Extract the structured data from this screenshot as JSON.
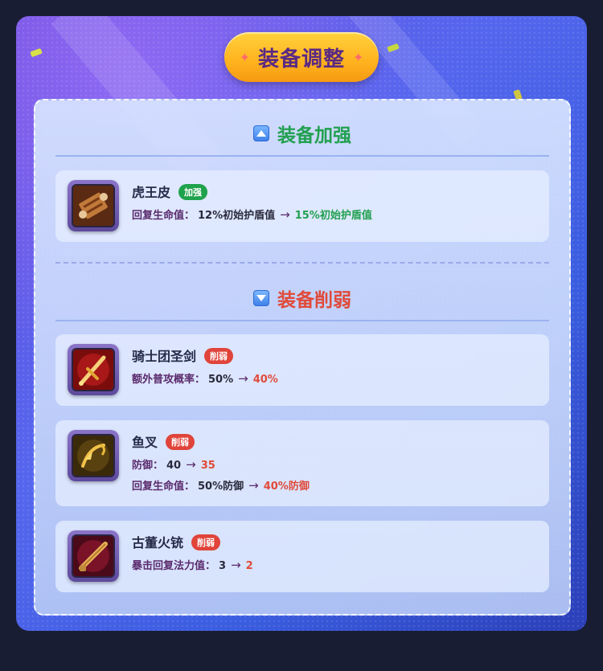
{
  "title": "装备调整",
  "colors": {
    "buff": "#22a050",
    "nerf": "#e04a3a",
    "badge_buff": "#1fa24c",
    "badge_nerf": "#e0443a"
  },
  "sections": [
    {
      "title": "装备加强",
      "icon": "triangle-up-icon",
      "items": [
        {
          "name": "虎王皮",
          "badge": "加强",
          "icon": "scroll-icon",
          "changes": [
            {
              "label": "回复生命值：",
              "old": "12%初始护盾值",
              "arrow": "→",
              "new": "15%初始护盾值"
            }
          ]
        }
      ]
    },
    {
      "title": "装备削弱",
      "icon": "triangle-down-icon",
      "items": [
        {
          "name": "骑士团圣剑",
          "badge": "削弱",
          "icon": "sword-icon",
          "changes": [
            {
              "label": "额外普攻概率：",
              "old": "50%",
              "arrow": "→",
              "new": "40%"
            }
          ]
        },
        {
          "name": "鱼叉",
          "badge": "削弱",
          "icon": "harpoon-icon",
          "changes": [
            {
              "label": "防御：",
              "old": "40",
              "arrow": "→",
              "new": "35"
            },
            {
              "label": "回复生命值：",
              "old": "50%防御",
              "arrow": "→",
              "new": "40%防御"
            }
          ]
        },
        {
          "name": "古董火铳",
          "badge": "削弱",
          "icon": "musket-icon",
          "changes": [
            {
              "label": "暴击回复法力值：",
              "old": "3",
              "arrow": "→",
              "new": "2"
            }
          ]
        }
      ]
    }
  ]
}
